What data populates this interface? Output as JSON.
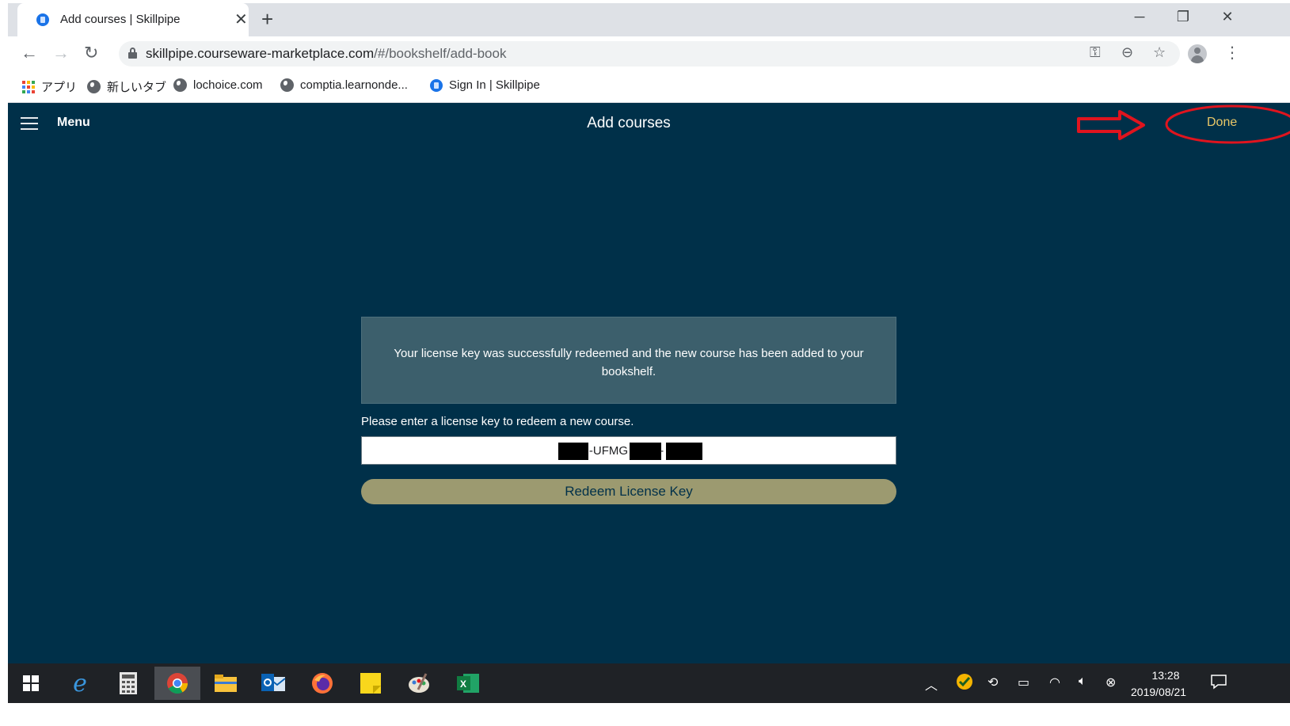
{
  "browser": {
    "tab_title": "Add courses | Skillpipe",
    "tab_close": "✕",
    "new_tab": "+",
    "url_host": "skillpipe.courseware-marketplace.com",
    "url_path": "/#/bookshelf/add-book",
    "window_controls": {
      "minimize": "─",
      "restore": "❐",
      "close": "✕"
    }
  },
  "bookmarks": [
    {
      "label": "アプリ",
      "icon": "apps-grid-icon"
    },
    {
      "label": "新しいタブ",
      "icon": "globe-icon"
    },
    {
      "label": "lochoice.com",
      "icon": "globe-icon"
    },
    {
      "label": "comptia.learnonde...",
      "icon": "globe-icon"
    },
    {
      "label": "Sign In | Skillpipe",
      "icon": "skillpipe-icon"
    }
  ],
  "app": {
    "menu_label": "Menu",
    "title": "Add courses",
    "done_label": "Done",
    "success_message": "Your license key was successfully redeemed and the new course has been added to your bookshelf.",
    "prompt": "Please enter a license key to redeem a new course.",
    "license_value_middle": "-UFMG",
    "license_value_dash": "-",
    "redeem_label": "Redeem License Key",
    "annotation_color": "#e0141e"
  },
  "taskbar": {
    "time": "13:28",
    "date": "2019/08/21"
  },
  "colors": {
    "app_background": "#003049",
    "done_text": "#e8c767",
    "button": "#9c9a70",
    "success_box": "#3c5f6c"
  }
}
